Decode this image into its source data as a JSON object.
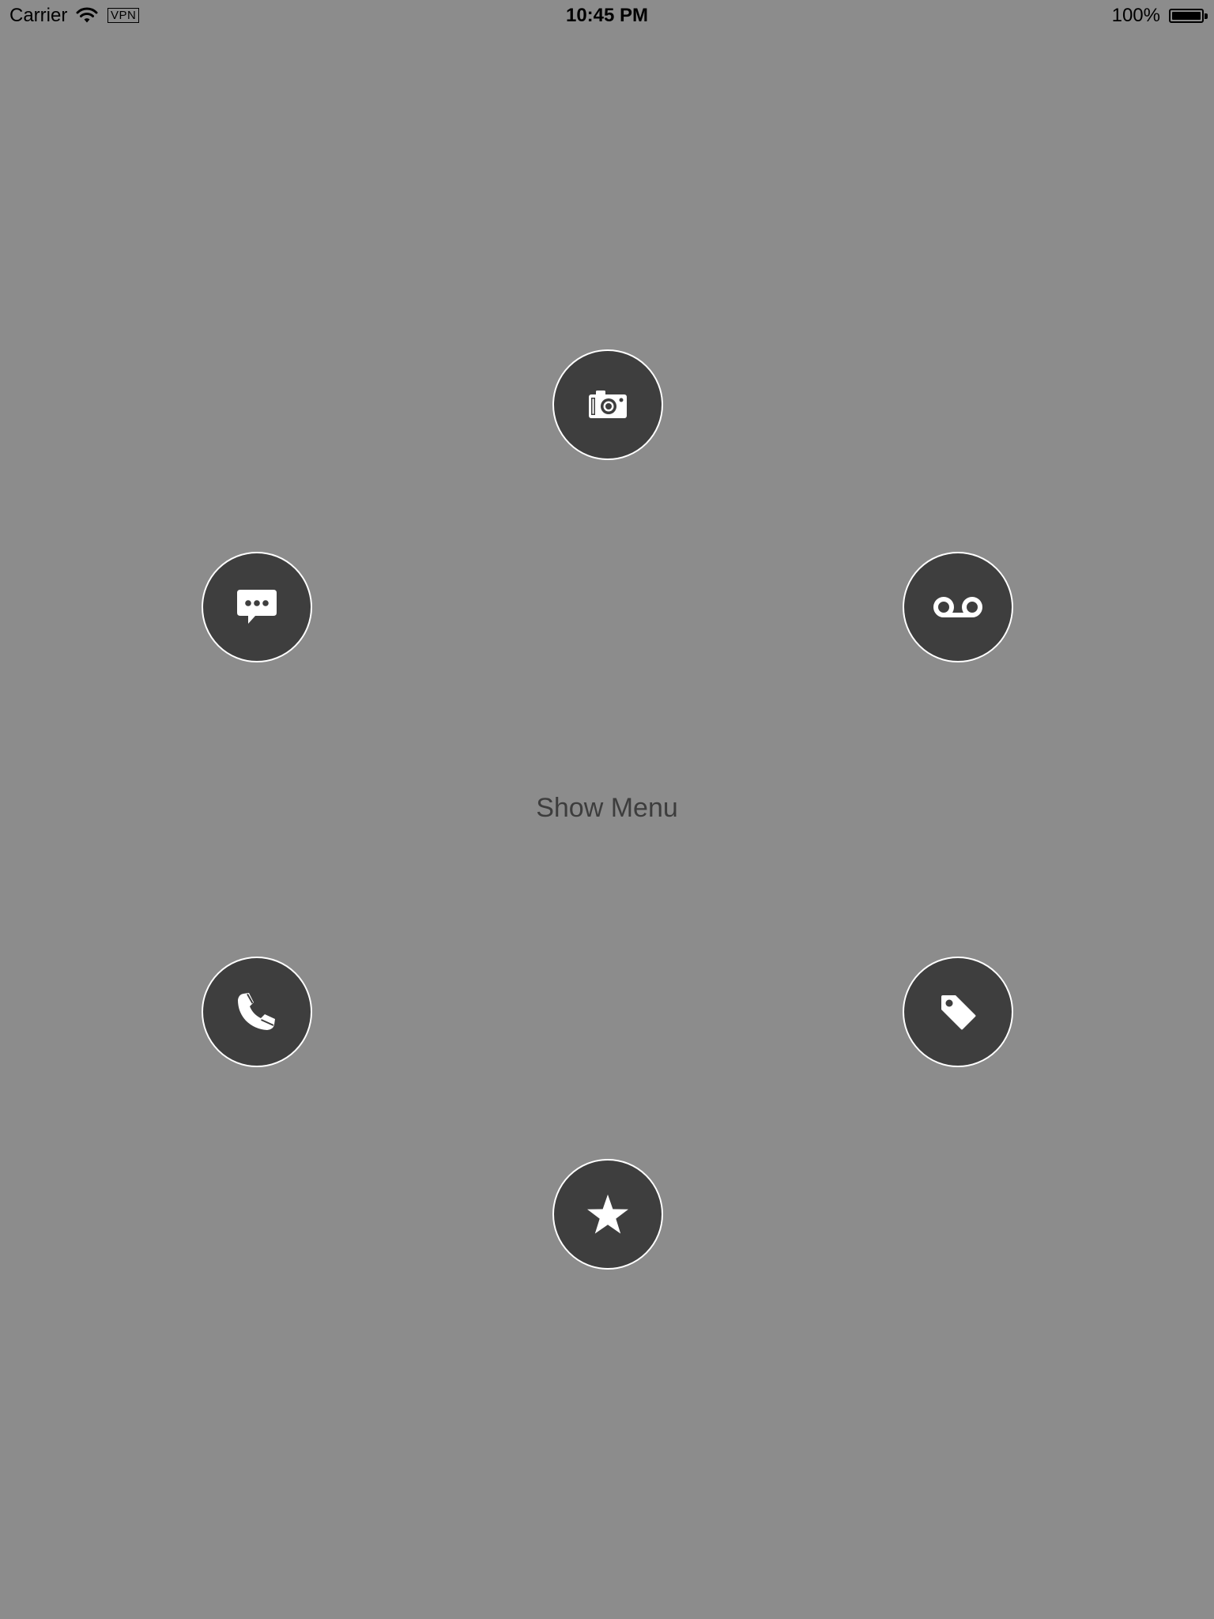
{
  "status_bar": {
    "carrier": "Carrier",
    "vpn_label": "VPN",
    "time": "10:45 PM",
    "battery_percent": "100%",
    "battery_level": 1.0
  },
  "main": {
    "show_menu_label": "Show Menu"
  },
  "menu_items": [
    {
      "icon": "camera-icon"
    },
    {
      "icon": "message-icon"
    },
    {
      "icon": "voicemail-icon"
    },
    {
      "icon": "phone-icon"
    },
    {
      "icon": "tag-icon"
    },
    {
      "icon": "star-icon"
    }
  ],
  "colors": {
    "background": "#8c8c8c",
    "button_fill": "#3e3e3e",
    "button_border": "#ffffff",
    "label_text": "#3d3d3d"
  }
}
